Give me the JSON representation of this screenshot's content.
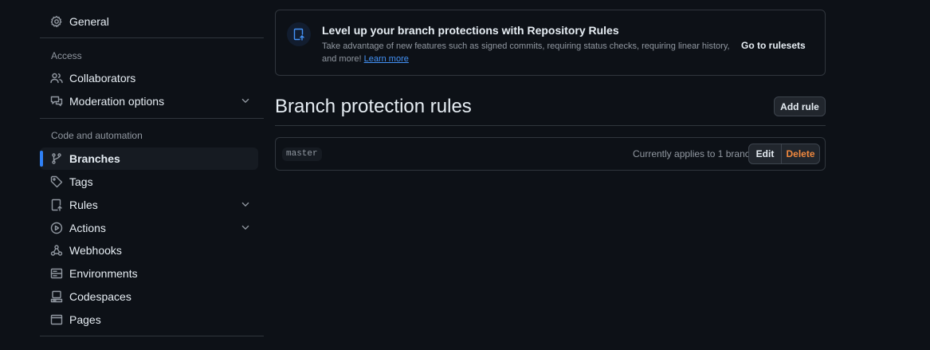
{
  "sidebar": {
    "general": "General",
    "access_header": "Access",
    "collaborators": "Collaborators",
    "moderation": "Moderation options",
    "code_header": "Code and automation",
    "branches": "Branches",
    "tags": "Tags",
    "rules": "Rules",
    "actions": "Actions",
    "webhooks": "Webhooks",
    "environments": "Environments",
    "codespaces": "Codespaces",
    "pages": "Pages"
  },
  "banner": {
    "icon": "ruleset-upload-icon",
    "title": "Level up your branch protections with Repository Rules",
    "description": "Take advantage of new features such as signed commits, requiring status checks, requiring linear history, and more!",
    "learn_more": "Learn more",
    "go_to": "Go to rulesets"
  },
  "main": {
    "title": "Branch protection rules",
    "add_rule": "Add rule",
    "rules": [
      {
        "name": "master",
        "applies": "Currently applies to 1 branch",
        "edit": "Edit",
        "delete": "Delete"
      }
    ]
  },
  "colors": {
    "background": "#0d1117",
    "accent": "#2f81f7",
    "link": "#4493f8",
    "danger": "#f0883e"
  }
}
